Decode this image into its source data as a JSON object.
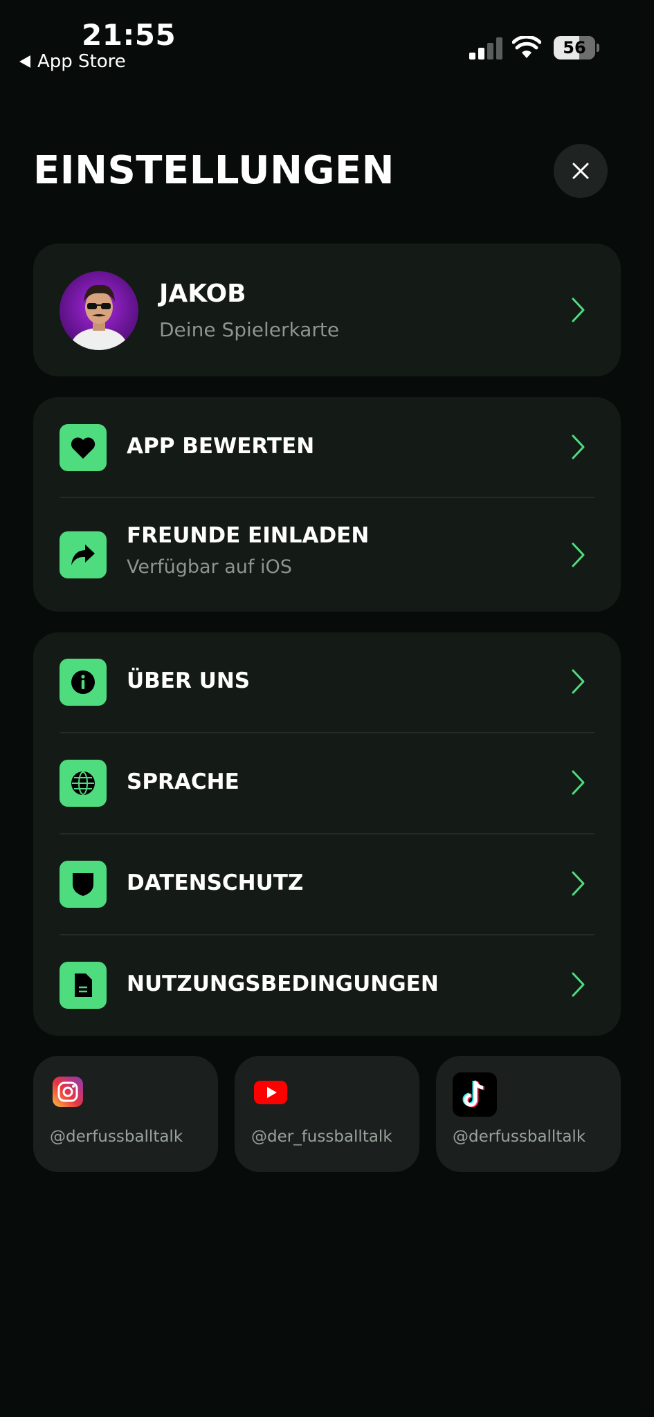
{
  "status_bar": {
    "time": "21:55",
    "back_label": "App Store",
    "battery": "56"
  },
  "header": {
    "title": "EINSTELLUNGEN",
    "close_icon": "close-icon"
  },
  "profile": {
    "name": "JAKOB",
    "subtitle": "Deine Spielerkarte"
  },
  "group1": [
    {
      "label": "APP BEWERTEN",
      "icon": "heart-icon"
    },
    {
      "label": "FREUNDE EINLADEN",
      "sub": "Verfügbar auf iOS",
      "icon": "share-icon"
    }
  ],
  "group2": [
    {
      "label": "ÜBER UNS",
      "icon": "info-icon"
    },
    {
      "label": "SPRACHE",
      "icon": "globe-icon"
    },
    {
      "label": "DATENSCHUTZ",
      "icon": "shield-icon"
    },
    {
      "label": "NUTZUNGSBEDINGUNGEN",
      "icon": "document-icon"
    }
  ],
  "social": [
    {
      "platform": "instagram",
      "handle": "@derfussballtalk"
    },
    {
      "platform": "youtube",
      "handle": "@der_fussballtalk"
    },
    {
      "platform": "tiktok",
      "handle": "@derfussballtalk"
    }
  ],
  "colors": {
    "background": "#070c0a",
    "card": "#141a15",
    "accent": "#4fdc7f",
    "secondary_text": "#8d958f"
  }
}
